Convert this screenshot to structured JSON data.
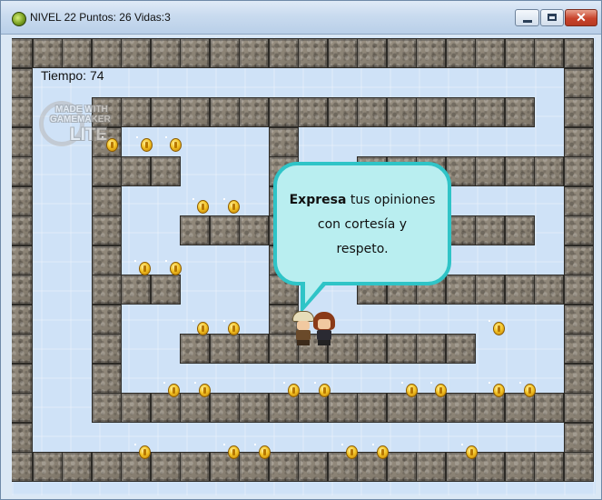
{
  "window": {
    "title": "NIVEL 22 Puntos: 26 Vidas:3",
    "controls": {
      "minimize": "minimize",
      "maximize": "maximize",
      "close": "✕"
    }
  },
  "hud": {
    "timer": "Tiempo: 74"
  },
  "watermark": {
    "line1": "MADE WITH",
    "line2": "GAMEMAKER",
    "line3": "LITE"
  },
  "dialog": {
    "bold": "Expresa",
    "line1_rest": " tus opiniones",
    "line2": "con cortesía y",
    "line3": "respeto."
  },
  "icons": {
    "app": "gamemaker-icon",
    "player": "explorer-character",
    "npc": "girl-character",
    "coin": "gold-coin-icon"
  },
  "colors": {
    "floor": "#cfe2f7",
    "wall": "#8a8174",
    "bubble_fill": "#b9eef0",
    "bubble_border": "#2fc4c7",
    "coin": "#f3c426"
  }
}
